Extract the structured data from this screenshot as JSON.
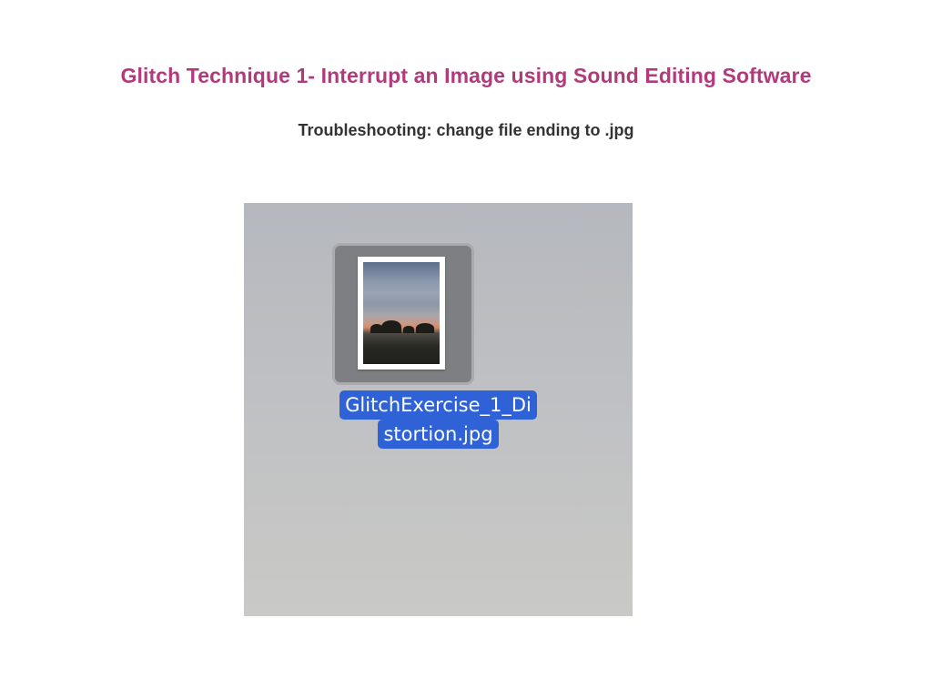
{
  "slide": {
    "title": "Glitch Technique 1- Interrupt an Image using Sound Editing Software",
    "subtitle": "Troubleshooting: change file ending to .jpg"
  },
  "finder": {
    "file": {
      "name_line1": "GlitchExercise_1_Di",
      "name_line2": "stortion.jpg",
      "icon": "jpg-file-thumbnail-icon",
      "selected": true
    }
  },
  "colors": {
    "title": "#b23a7c",
    "subtitle": "#333333",
    "selection": "#2f62d6",
    "desktop": "#c0c1c3"
  }
}
